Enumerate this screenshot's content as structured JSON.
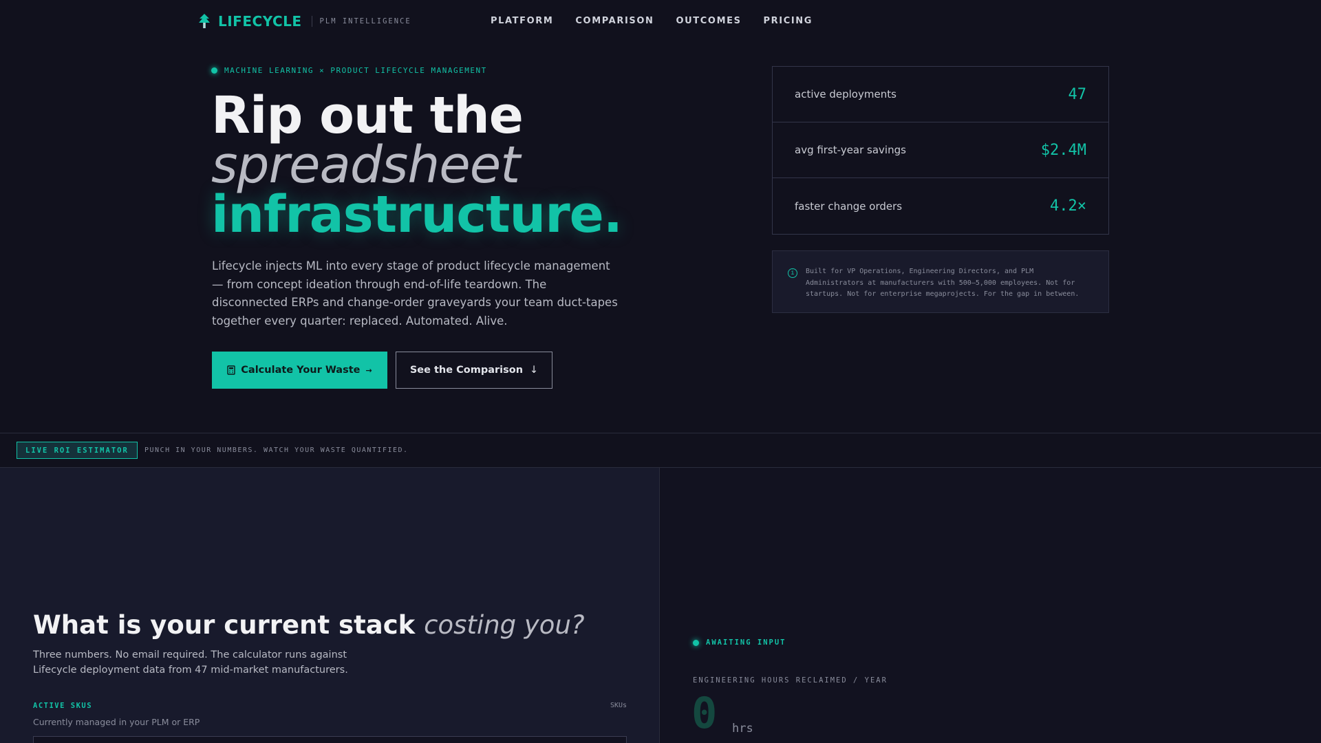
{
  "colors": {
    "accent": "#12c3a7",
    "background": "#11111d",
    "panel": "#181a2c"
  },
  "nav": {
    "brand": "LIFECYCLE",
    "brand_icon": "tree-icon",
    "tagline": "PLM INTELLIGENCE",
    "links": [
      "PLATFORM",
      "COMPARISON",
      "OUTCOMES",
      "PRICING"
    ]
  },
  "hero": {
    "eyebrow": "MACHINE LEARNING × PRODUCT LIFECYCLE MANAGEMENT",
    "headline_line1": "Rip out the",
    "headline_line2": "spreadsheet",
    "headline_line3": "infrastructure.",
    "description": "Lifecycle injects ML into every stage of product lifecycle management — from concept ideation through end-of-life teardown. The disconnected ERPs and change-order graveyards your team duct-tapes together every quarter: replaced. Automated. Alive.",
    "cta_primary": "Calculate Your Waste",
    "cta_primary_icon": "calculator-icon",
    "cta_primary_arrow": "→",
    "cta_secondary": "See the Comparison",
    "cta_secondary_arrow": "↓"
  },
  "stats": [
    {
      "label": "active deployments",
      "value": "47"
    },
    {
      "label": "avg first-year savings",
      "value": "$2.4M"
    },
    {
      "label": "faster change orders",
      "value": "4.2×"
    }
  ],
  "note": {
    "icon": "info-icon",
    "text": "Built for VP Operations, Engineering Directors, and PLM Administrators at manufacturers with 500–5,000 employees. Not for startups. Not for enterprise megaprojects. For the gap in between."
  },
  "band": {
    "badge": "LIVE ROI ESTIMATOR",
    "text": "PUNCH IN YOUR NUMBERS. WATCH YOUR WASTE QUANTIFIED."
  },
  "calculator": {
    "title_main": "What is your current stack",
    "title_em": "costing you?",
    "description": "Three numbers. No email required. The calculator runs against Lifecycle deployment data from 47 mid-market manufacturers.",
    "field": {
      "label": "ACTIVE SKUS",
      "unit": "SKUs",
      "help": "Currently managed in your PLM or ERP",
      "value": ""
    }
  },
  "result": {
    "status": "AWAITING INPUT",
    "label": "ENGINEERING HOURS RECLAIMED / YEAR",
    "value": "0",
    "unit": "hrs"
  }
}
